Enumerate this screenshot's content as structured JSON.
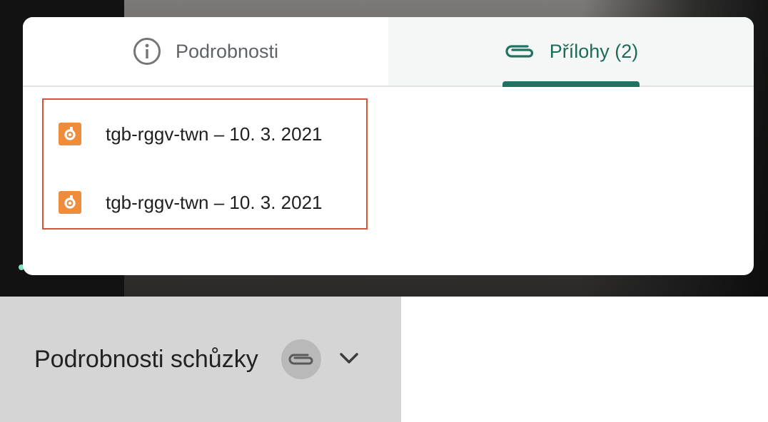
{
  "tabs": {
    "details_label": "Podrobnosti",
    "attachments_label": "Přílohy (2)"
  },
  "attachments": [
    {
      "name": "tgb-rggv-twn – 10. 3. 2021",
      "icon": "jamboard-file-icon"
    },
    {
      "name": "tgb-rggv-twn – 10. 3. 2021",
      "icon": "jamboard-file-icon"
    }
  ],
  "meeting_details": {
    "title": "Podrobnosti schůzky"
  },
  "colors": {
    "accent": "#1e7461",
    "file_icon": "#ef8c3c",
    "highlight_border": "#d9523a"
  }
}
